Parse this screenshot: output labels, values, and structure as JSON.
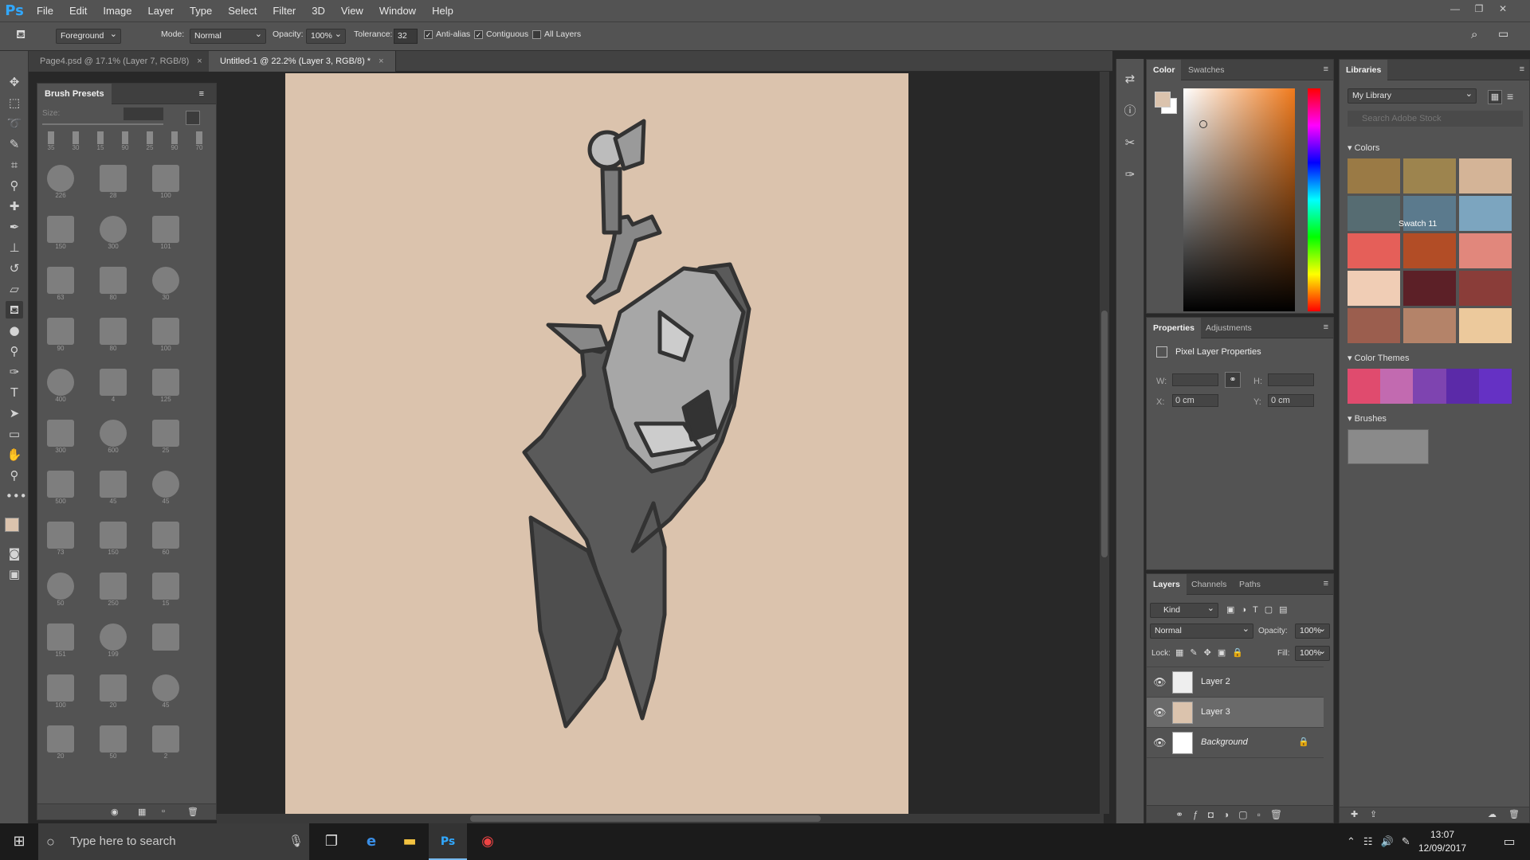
{
  "app": {
    "logo": "Ps"
  },
  "menu": [
    "File",
    "Edit",
    "Image",
    "Layer",
    "Type",
    "Select",
    "Filter",
    "3D",
    "View",
    "Window",
    "Help"
  ],
  "options": {
    "fill_source": "Foreground",
    "mode_label": "Mode:",
    "mode_value": "Normal",
    "opacity_label": "Opacity:",
    "opacity_value": "100%",
    "tolerance_label": "Tolerance:",
    "tolerance_value": "32",
    "anti_alias": "Anti-alias",
    "contiguous": "Contiguous",
    "all_layers": "All Layers"
  },
  "tabs": [
    {
      "label": "Page4.psd @ 17.1% (Layer 7, RGB/8)",
      "active": false
    },
    {
      "label": "Untitled-1 @ 22.2% (Layer 3, RGB/8) *",
      "active": true
    }
  ],
  "brush_panel": {
    "title": "Brush Presets",
    "size_label": "Size:",
    "presets": [
      "226",
      "28",
      "100",
      "150",
      "300",
      "101",
      "63",
      "80",
      "30",
      "90",
      "80",
      "100",
      "400",
      "4",
      "125",
      "300",
      "600",
      "25",
      "500",
      "45",
      "45",
      "73",
      "150",
      "60",
      "50",
      "250",
      "15",
      "151",
      "199",
      "",
      "100",
      "20",
      "45",
      "20",
      "50",
      "2"
    ],
    "tip_sizes": [
      "35",
      "30",
      "15",
      "90",
      "25",
      "90",
      "70"
    ]
  },
  "color_panel": {
    "tabs": [
      "Color",
      "Swatches"
    ],
    "foreground": "#dbc3ad",
    "background": "#ffffff"
  },
  "properties_panel": {
    "tabs": [
      "Properties",
      "Adjustments"
    ],
    "title": "Pixel Layer Properties",
    "w_label": "W:",
    "h_label": "H:",
    "x_label": "X:",
    "x_value": "0 cm",
    "y_label": "Y:",
    "y_value": "0 cm"
  },
  "layers_panel": {
    "tabs": [
      "Layers",
      "Channels",
      "Paths"
    ],
    "filter": "Kind",
    "blend": "Normal",
    "opacity_label": "Opacity:",
    "opacity_value": "100%",
    "lock_label": "Lock:",
    "fill_label": "Fill:",
    "fill_value": "100%",
    "layers": [
      {
        "name": "Layer 2",
        "selected": false
      },
      {
        "name": "Layer 3",
        "selected": true
      },
      {
        "name": "Background",
        "selected": false
      }
    ]
  },
  "libraries": {
    "title": "Libraries",
    "library": "My Library",
    "search_placeholder": "Search Adobe Stock",
    "colors_label": "Colors",
    "swatches": [
      "#9a7a45",
      "#9d844e",
      "#d4b497",
      "#566c72",
      "#5b7a8d",
      "#7ca5bf",
      "#e55f59",
      "#b24d26",
      "#e1877c",
      "#f0cdb5",
      "#5c2027",
      "#8a3d39",
      "#9b5e4e",
      "#b48369",
      "#ecc99c"
    ],
    "swatch_tooltip": "Swatch 11",
    "themes_label": "Color Themes",
    "themes": [
      "#e04b6e",
      "#c26ab0",
      "#7e44b0",
      "#5b2aa8",
      "#6531c4"
    ],
    "brushes_label": "Brushes"
  },
  "taskbar": {
    "search_placeholder": "Type here to search",
    "time": "13:07",
    "date": "12/09/2017"
  }
}
